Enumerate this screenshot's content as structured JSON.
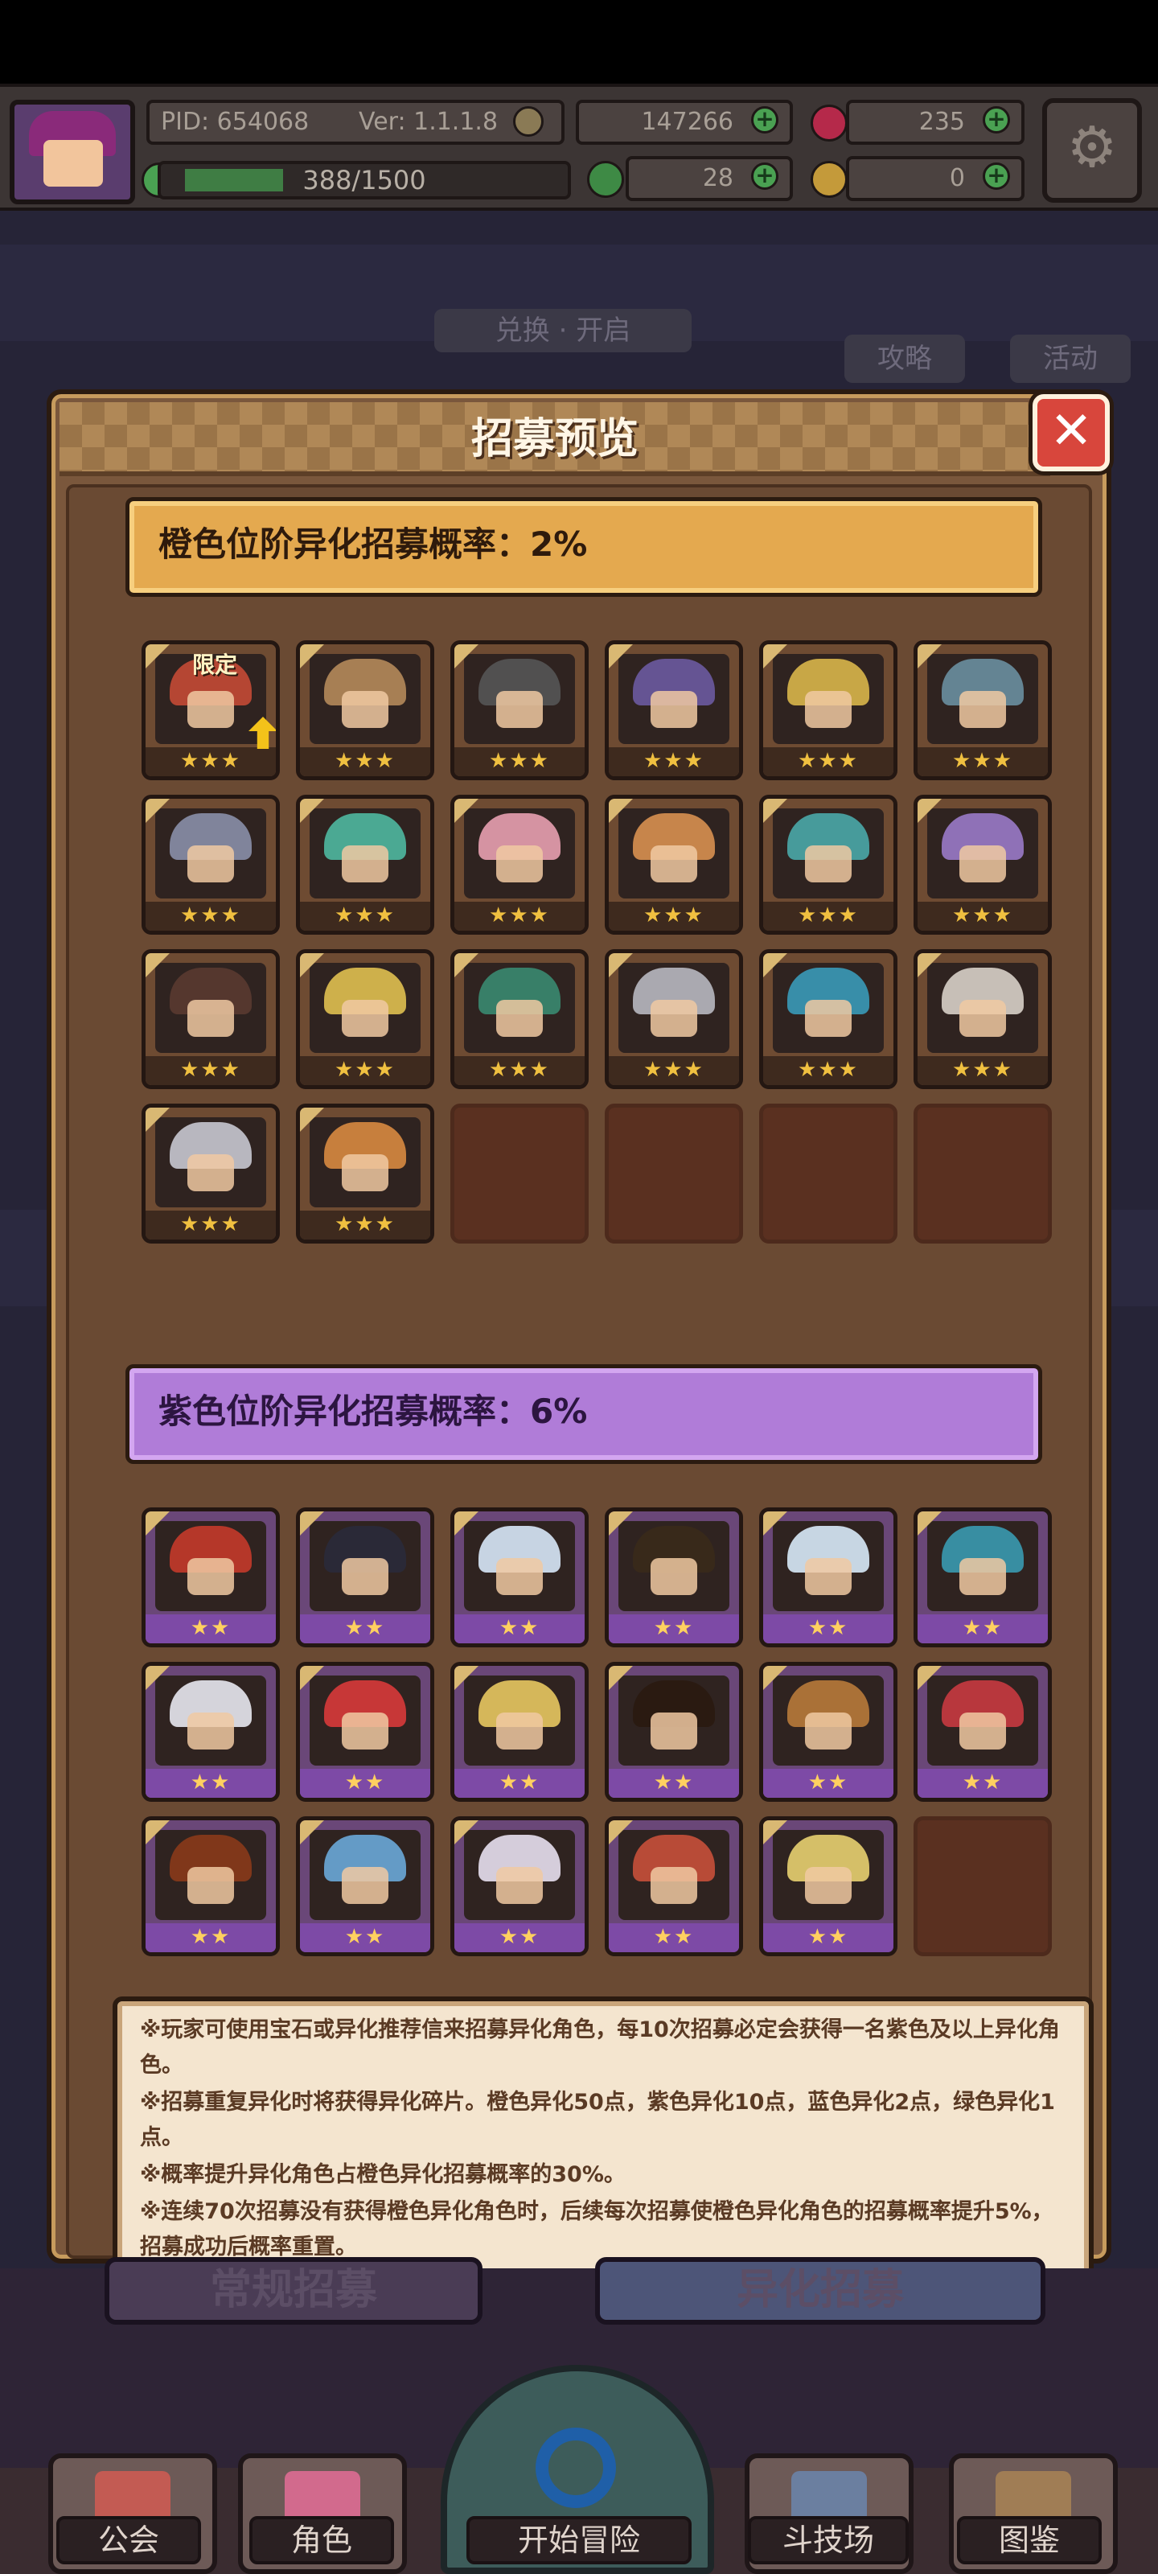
{
  "hud": {
    "pid": "PID: 654068",
    "version": "Ver: 1.1.1.8",
    "gold": "147266",
    "gems": "235",
    "xp": "388/1500",
    "xp_fraction": 0.26,
    "clover": "28",
    "key": "0"
  },
  "background": {
    "exchange_label": "兑换",
    "exchange_label_suffix": "开启",
    "guide_label": "攻略",
    "activity_label": "活动",
    "normal_recruit_label": "常规招募",
    "alien_recruit_label": "异化招募"
  },
  "modal": {
    "title": "招募预览",
    "close_symbol": "✕",
    "orange_banner": "橙色位阶异化招募概率：2%",
    "purple_banner": "紫色位阶异化招募概率：6%",
    "limited_tag": "限定",
    "orange_stars": "★★★",
    "purple_stars": "★★",
    "notes": [
      "※玩家可使用宝石或异化推荐信来招募异化角色，每10次招募必定会获得一名紫色及以上异化角色。",
      "※招募重复异化时将获得异化碎片。橙色异化50点，紫色异化10点，蓝色异化2点，绿色异化1点。",
      "※概率提升异化角色占橙色异化招募概率的30%。",
      "※连续70次招募没有获得橙色异化角色时，后续每次招募使橙色异化角色的招募概率提升5%，招募成功后概率重置。"
    ]
  },
  "nav": {
    "guild": "公会",
    "character": "角色",
    "start": "开始冒险",
    "arena": "斗技场",
    "codex": "图鉴"
  },
  "colors": {
    "orange_accent": "#e4a94f",
    "purple_accent": "#b07cd8",
    "modal_bg": "#7a573c",
    "close_red": "#d8463c"
  }
}
